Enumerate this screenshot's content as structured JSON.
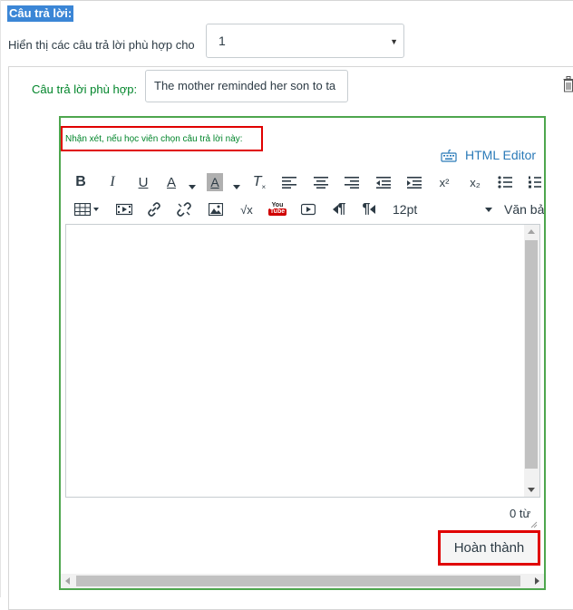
{
  "section_title": "Câu trả lời:",
  "show_matches": {
    "label": "Hiển thị các câu trả lời phù hợp cho",
    "selected": "1",
    "caret": "▼"
  },
  "answer": {
    "label": "Câu trả lời phù hợp:",
    "value": "The mother reminded her son to ta"
  },
  "comment": {
    "label": "Nhận xét, nếu học viên chọn câu trả lời này:",
    "html_editor_label": "HTML Editor",
    "font_size": "12pt",
    "paragraph_style": "Văn bả",
    "word_count": "0 từ",
    "done_label": "Hoàn thành"
  },
  "toolbar": {
    "bold": "B",
    "italic": "I",
    "underline": "U",
    "font_color": "A",
    "bg_color": "A",
    "clear_format": "T",
    "superscript": "x²",
    "subscript": "x₂",
    "math": "√x",
    "youtube_top": "You",
    "youtube_bottom": "Tube",
    "ltr": "¶",
    "rtl": "¶"
  },
  "colors": {
    "highlight": "#3b86d6",
    "green_text": "#00852a",
    "green_border": "#4ea64e",
    "red_callout": "#e00000",
    "link_blue": "#2a7ab8"
  }
}
